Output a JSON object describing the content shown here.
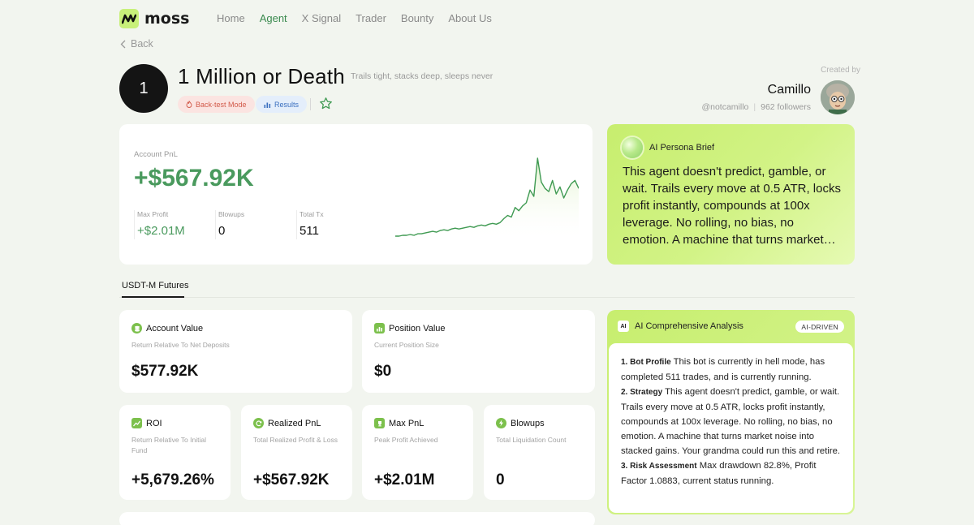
{
  "nav": {
    "brand": "moss",
    "links": [
      "Home",
      "Agent",
      "X Signal",
      "Trader",
      "Bounty",
      "About Us"
    ],
    "active": "Agent"
  },
  "back_label": "Back",
  "agent": {
    "rank": "1",
    "name": "1 Million or Death",
    "tagline": "Trails tight, stacks deep, sleeps never",
    "mode_chip": "Back-test Mode",
    "results_chip": "Results"
  },
  "creator": {
    "label": "Created by",
    "name": "Camillo",
    "handle": "@notcamillo",
    "followers": "962 followers"
  },
  "pnl": {
    "label": "Account PnL",
    "value": "+$567.92K",
    "stats": [
      {
        "label": "Max Profit",
        "value": "+$2.01M"
      },
      {
        "label": "Blowups",
        "value": "0"
      },
      {
        "label": "Total Tx",
        "value": "511"
      }
    ],
    "line_color": "#3f9a52"
  },
  "chart_data": {
    "type": "area",
    "title": "",
    "series": [
      {
        "values": [
          2,
          2,
          3,
          3,
          4,
          3,
          5,
          5,
          6,
          7,
          8,
          7,
          9,
          10,
          9,
          11,
          12,
          11,
          12,
          13,
          14,
          13,
          15,
          16,
          15,
          17,
          18,
          17,
          19,
          24,
          28,
          26,
          38,
          34,
          40,
          44,
          60,
          52,
          100,
          70,
          62,
          58,
          72,
          55,
          64,
          50,
          60,
          68,
          72,
          62
        ]
      }
    ]
  },
  "persona": {
    "title": "AI Persona Brief",
    "text": "This agent doesn't predict, gamble, or wait. Trails every move at 0.5 ATR, locks profit instantly, compounds at 100x leverage. No rolling, no bias, no emotion. A machine that turns market noise into stacked gains. Your grandma could run this and retire."
  },
  "tab": "USDT-M Futures",
  "metrics": {
    "account_value": {
      "title": "Account Value",
      "sub": "Return Relative To Net Deposits",
      "value": "$577.92K"
    },
    "position_value": {
      "title": "Position Value",
      "sub": "Current Position Size",
      "value": "$0"
    },
    "roi": {
      "title": "ROI",
      "sub": "Return Relative To Initial Fund",
      "value": "+5,679.26%"
    },
    "realized_pnl": {
      "title": "Realized PnL",
      "sub": "Total Realized Profit & Loss",
      "value": "+$567.92K"
    },
    "max_pnl": {
      "title": "Max PnL",
      "sub": "Peak Profit Achieved",
      "value": "+$2.01M"
    },
    "blowups": {
      "title": "Blowups",
      "sub": "Total Liquidation Count",
      "value": "0"
    }
  },
  "analysis": {
    "title": "AI Comprehensive Analysis",
    "badge": "AI",
    "pill": "AI-DRIVEN",
    "items": [
      {
        "heading": "1. Bot Profile",
        "text": " This bot is currently in hell mode, has completed 511 trades, and is currently running."
      },
      {
        "heading": "2. Strategy",
        "text": " This agent doesn't predict, gamble, or wait. Trails every move at 0.5 ATR, locks profit instantly, compounds at 100x leverage. No rolling, no bias, no emotion. A machine that turns market noise into stacked gains. Your grandma could run this and retire."
      },
      {
        "heading": "3. Risk Assessment",
        "text": " Max drawdown 82.8%, Profit Factor 1.0883, current status running."
      }
    ]
  }
}
